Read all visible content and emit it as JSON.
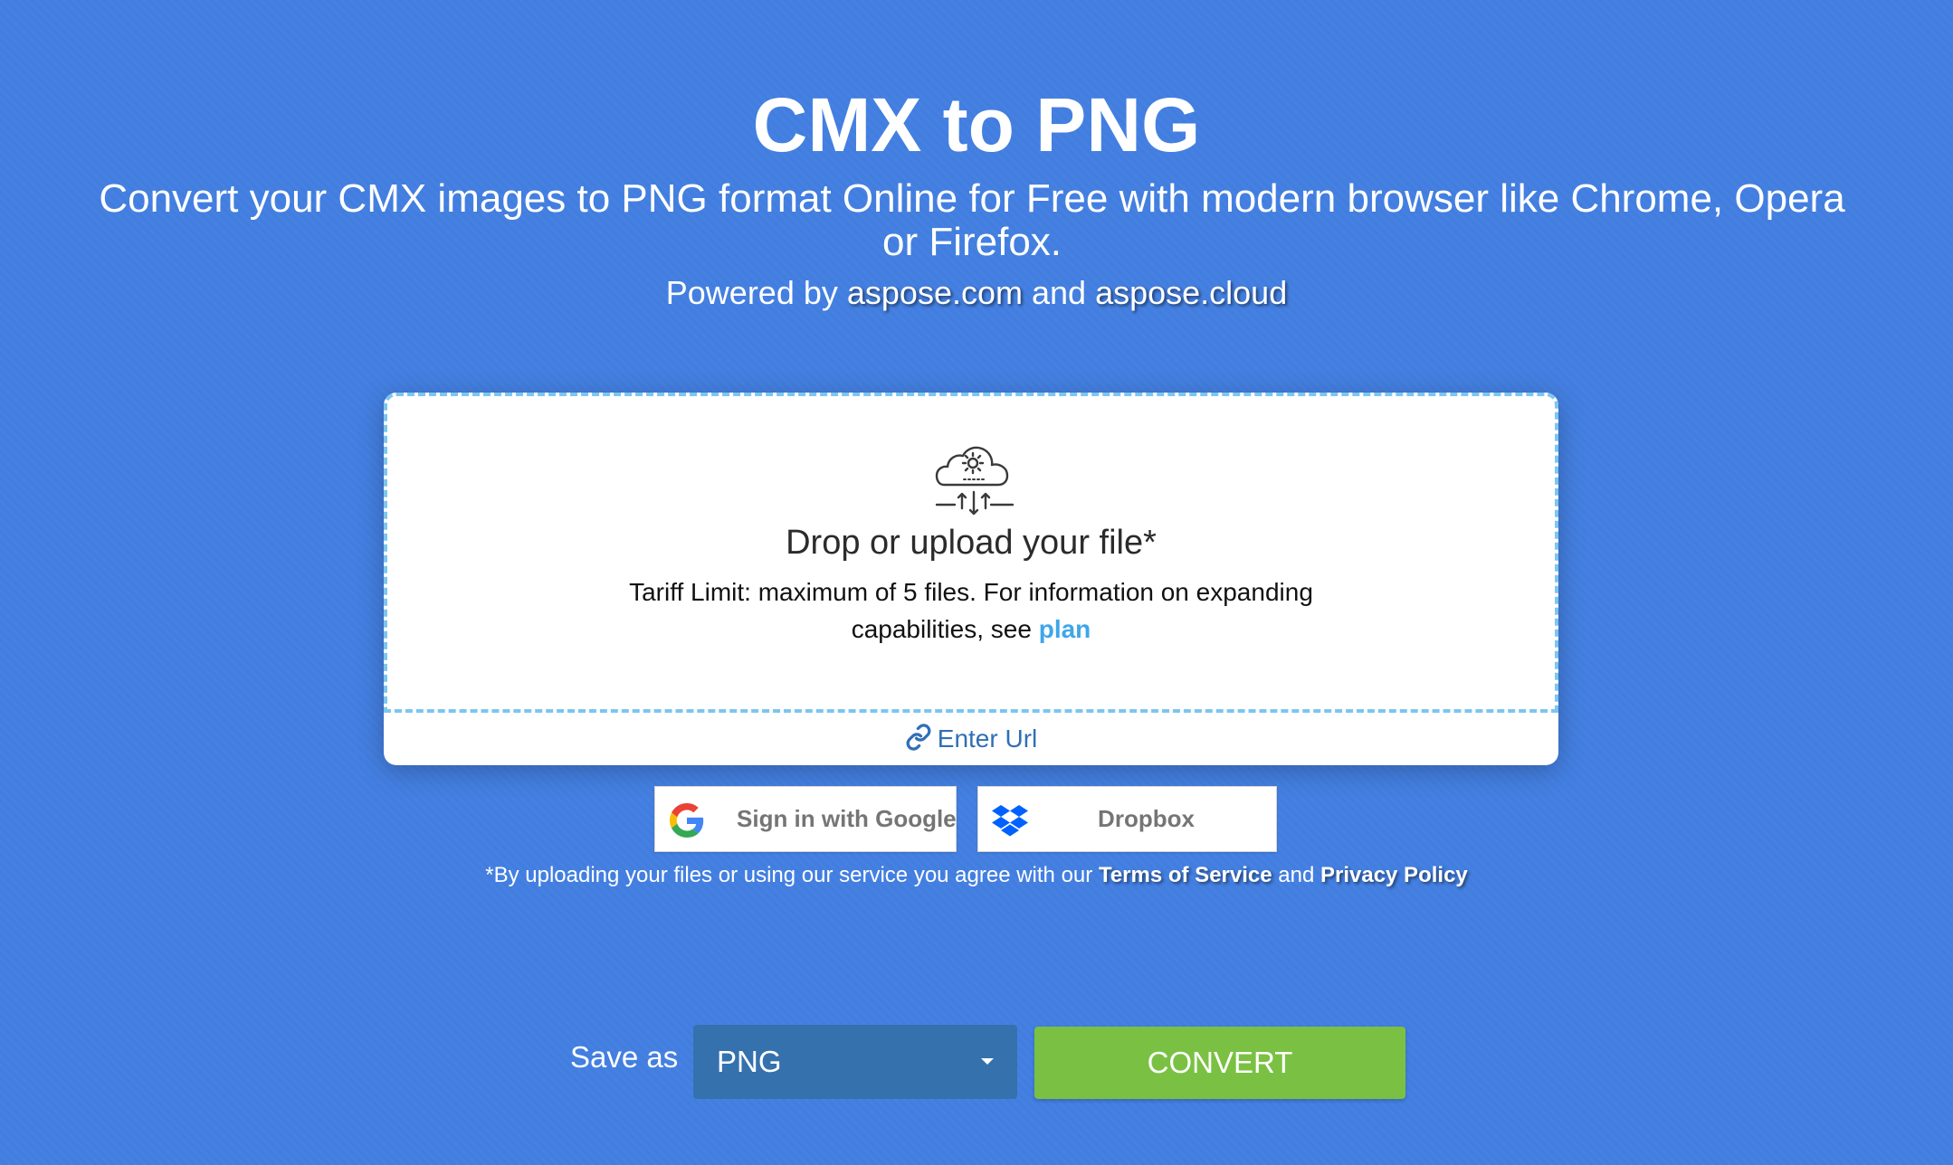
{
  "hero": {
    "title": "CMX to PNG",
    "subtitle": "Convert your CMX images to PNG format Online for Free with modern browser like Chrome, Opera or Firefox.",
    "powered_prefix": "Powered by ",
    "powered_link1": "aspose.com",
    "powered_and": " and ",
    "powered_link2": "aspose.cloud"
  },
  "upload": {
    "icon": "cloud-upload-gear-icon",
    "title": "Drop or upload your file*",
    "tariff_text": "Tariff Limit: maximum of 5 files. For information on expanding capabilities, see ",
    "plan_link": "plan",
    "enter_url": "Enter Url",
    "enter_url_icon": "link-icon"
  },
  "sources": {
    "google_label": "Sign in with Google",
    "google_icon": "google-icon",
    "dropbox_label": "Dropbox",
    "dropbox_icon": "dropbox-icon"
  },
  "terms": {
    "prefix": "*By uploading your files or using our service you agree with our ",
    "tos": "Terms of Service",
    "and": " and ",
    "privacy": "Privacy Policy"
  },
  "actions": {
    "save_as_label": "Save as",
    "format_value": "PNG",
    "convert_label": "CONVERT"
  },
  "colors": {
    "background": "#427ee0",
    "convert": "#7ac143",
    "select": "#3571ad",
    "dashed_border": "#7cc6f0",
    "plan_link": "#3ea6ea"
  }
}
